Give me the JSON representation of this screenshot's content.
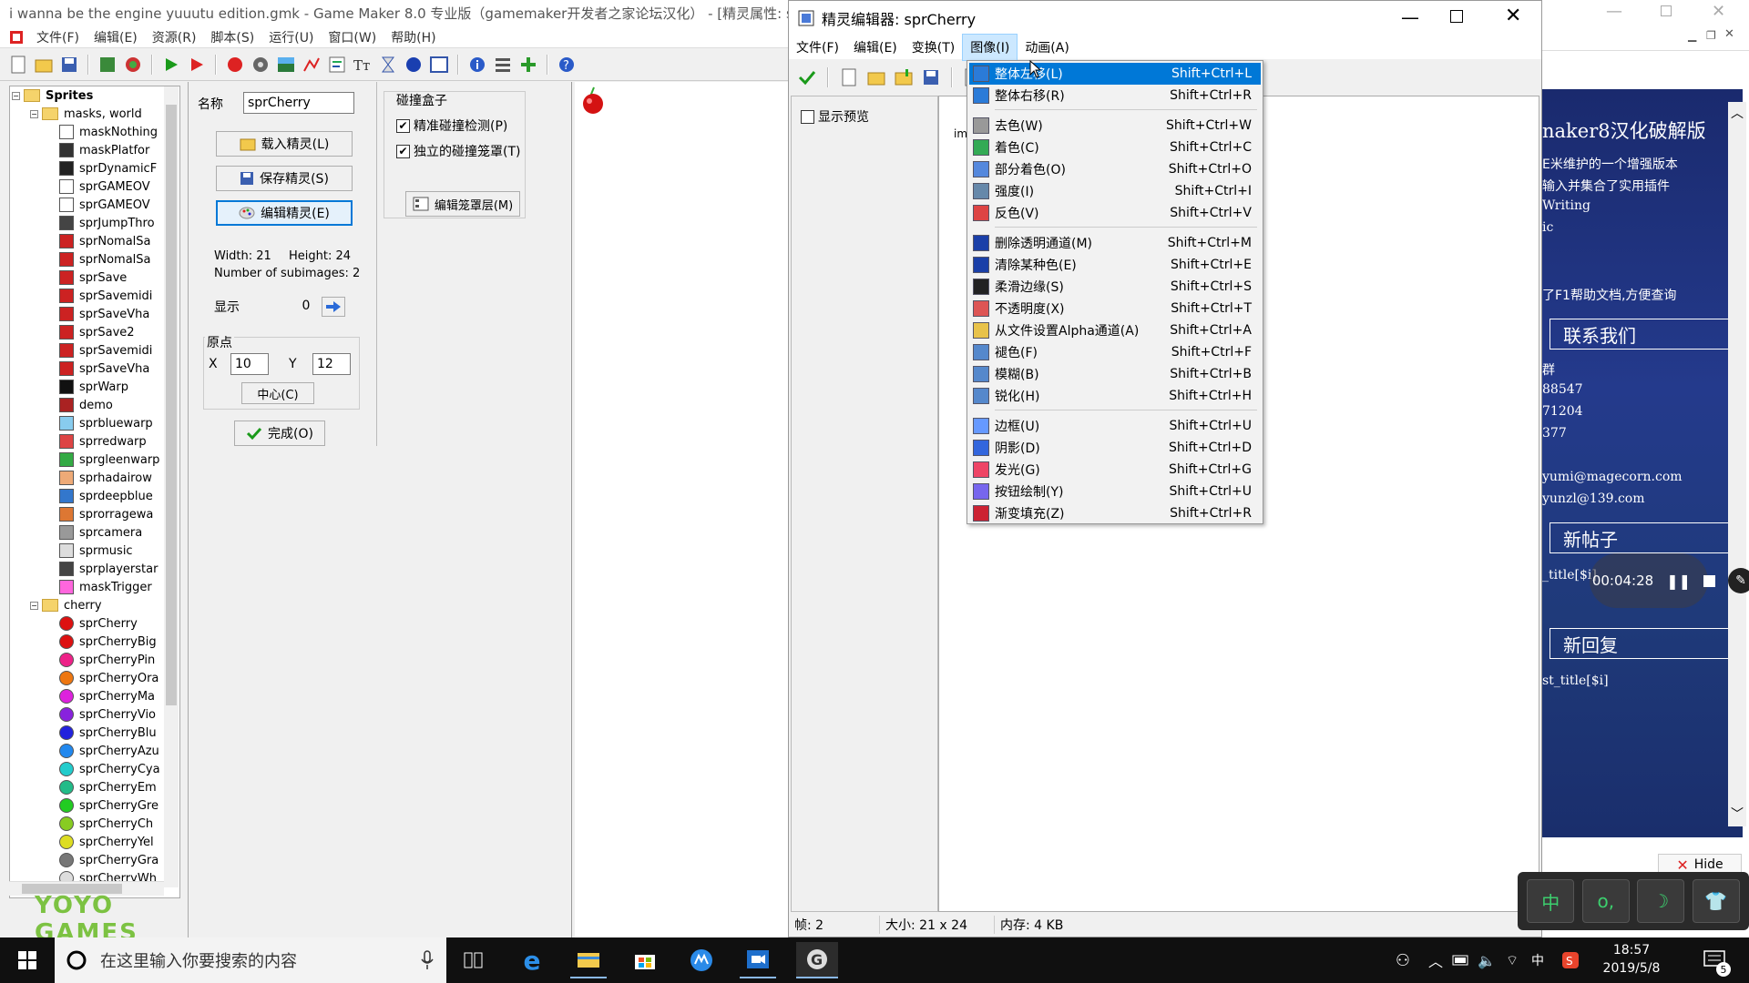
{
  "gm": {
    "title": "i wanna be the engine yuuutu edition.gmk - Game Maker 8.0 专业版（gamemaker开发者之家论坛汉化） - [精灵属性: sp",
    "menu": [
      "文件(F)",
      "编辑(E)",
      "资源(R)",
      "脚本(S)",
      "运行(U)",
      "窗口(W)",
      "帮助(H)"
    ]
  },
  "tree": {
    "root": "Sprites",
    "folder1": "masks, world",
    "items1": [
      "maskNothing",
      "maskPlatfor",
      "sprDynamicF",
      "sprGAMEOV",
      "sprGAMEOV",
      "sprJumpThro",
      "sprNomalSa",
      "sprNomalSa",
      "sprSave",
      "sprSavemidi",
      "sprSaveVha",
      "sprSave2",
      "sprSavemidi",
      "sprSaveVha",
      "sprWarp",
      "demo",
      "sprbluewarp",
      "sprredwarp",
      "sprgleenwarp",
      "sprhadairow",
      "sprdeepblue",
      "sprorragewa",
      "sprcamera",
      "sprmusic",
      "sprplayerstar",
      "maskTrigger"
    ],
    "folder2": "cherry",
    "items2": [
      "sprCherry",
      "sprCherryBig",
      "sprCherryPin",
      "sprCherryOra",
      "sprCherryMa",
      "sprCherryVio",
      "sprCherryBlu",
      "sprCherryAzu",
      "sprCherryCya",
      "sprCherryEm",
      "sprCherryGre",
      "sprCherryCh",
      "sprCherryYel",
      "sprCherryGra",
      "sprCherryWh"
    ],
    "colors1": [
      "#ffffff",
      "#333333",
      "#222222",
      "#ffffff",
      "#ffffff",
      "#444444",
      "#cc2222",
      "#cc2222",
      "#cc2222",
      "#cc2222",
      "#cc2222",
      "#cc2222",
      "#cc2222",
      "#cc2222",
      "#111111",
      "#aa2222",
      "#88ccee",
      "#dd4444",
      "#33aa44",
      "#eeaa77",
      "#3377cc",
      "#dd7733",
      "#999999",
      "#dddddd",
      "#444444",
      "#ff66dd"
    ],
    "colors2": [
      "#dd1111",
      "#dd1111",
      "#ee2288",
      "#ee7711",
      "#dd22dd",
      "#8822dd",
      "#2222dd",
      "#2288ee",
      "#22cccc",
      "#22bb88",
      "#22cc22",
      "#88cc22",
      "#dddd22",
      "#777777",
      "#dddddd"
    ]
  },
  "logo": "YOYO GAMES",
  "props": {
    "name_label": "名称",
    "name_value": "sprCherry",
    "load_btn": "载入精灵(L)",
    "save_btn": "保存精灵(S)",
    "edit_btn": "编辑精灵(E)",
    "width": "Width: 21",
    "height": "Height: 24",
    "subimages": "Number of subimages: 2",
    "show_label": "显示",
    "show_value": "0",
    "origin_label": "原点",
    "x_label": "X",
    "x_value": "10",
    "y_label": "Y",
    "y_value": "12",
    "center_btn": "中心(C)",
    "done_btn": "完成(O)",
    "collision_label": "碰撞盒子",
    "precise_chk": "精准碰撞检测(P)",
    "separate_chk": "独立的碰撞笼罩(T)",
    "mask_btn": "编辑笼罩层(M)"
  },
  "editor": {
    "title": "精灵编辑器: sprCherry",
    "menu": [
      "文件(F)",
      "编辑(E)",
      "变换(T)",
      "图像(I)",
      "动画(A)"
    ],
    "preview_chk": "显示预览",
    "canvas_text": "im",
    "status_frames": "帧: 2",
    "status_size": "大小: 21 x 24",
    "status_mem": "内存: 4 KB"
  },
  "dropdown": [
    {
      "label": "整体左移(L)",
      "shortcut": "Shift+Ctrl+L",
      "icon": "shift-left-icon",
      "color": "#2b7bd8"
    },
    {
      "label": "整体右移(R)",
      "shortcut": "Shift+Ctrl+R",
      "icon": "shift-right-icon",
      "color": "#2b7bd8"
    },
    {
      "label": "去色(W)",
      "shortcut": "Shift+Ctrl+W",
      "icon": "grayscale-icon",
      "color": "#999999"
    },
    {
      "label": "着色(C)",
      "shortcut": "Shift+Ctrl+C",
      "icon": "colorize-icon",
      "color": "#33aa55"
    },
    {
      "label": "部分着色(O)",
      "shortcut": "Shift+Ctrl+O",
      "icon": "partial-colorize-icon",
      "color": "#5588dd"
    },
    {
      "label": "强度(I)",
      "shortcut": "Shift+Ctrl+I",
      "icon": "intensity-icon",
      "color": "#6688aa"
    },
    {
      "label": "反色(V)",
      "shortcut": "Shift+Ctrl+V",
      "icon": "invert-icon",
      "color": "#dd4444"
    },
    {
      "label": "删除透明通道(M)",
      "shortcut": "Shift+Ctrl+M",
      "icon": "remove-alpha-icon",
      "color": "#1a3fa8"
    },
    {
      "label": "清除某种色(E)",
      "shortcut": "Shift+Ctrl+E",
      "icon": "erase-color-icon",
      "color": "#1a3fa8"
    },
    {
      "label": "柔滑边缘(S)",
      "shortcut": "Shift+Ctrl+S",
      "icon": "smooth-edges-icon",
      "color": "#222222"
    },
    {
      "label": "不透明度(X)",
      "shortcut": "Shift+Ctrl+T",
      "icon": "opacity-icon",
      "color": "#dd5555"
    },
    {
      "label": "从文件设置Alpha通道(A)",
      "shortcut": "Shift+Ctrl+A",
      "icon": "alpha-file-icon",
      "color": "#e8c24a"
    },
    {
      "label": "褪色(F)",
      "shortcut": "Shift+Ctrl+F",
      "icon": "fade-icon",
      "color": "#5588cc"
    },
    {
      "label": "模糊(B)",
      "shortcut": "Shift+Ctrl+B",
      "icon": "blur-icon",
      "color": "#5588cc"
    },
    {
      "label": "锐化(H)",
      "shortcut": "Shift+Ctrl+H",
      "icon": "sharpen-icon",
      "color": "#5588cc"
    },
    {
      "label": "边框(U)",
      "shortcut": "Shift+Ctrl+U",
      "icon": "outline-icon",
      "color": "#6699ff"
    },
    {
      "label": "阴影(D)",
      "shortcut": "Shift+Ctrl+D",
      "icon": "shadow-icon",
      "color": "#3366dd"
    },
    {
      "label": "发光(G)",
      "shortcut": "Shift+Ctrl+G",
      "icon": "glow-icon",
      "color": "#ee4466"
    },
    {
      "label": "按钮绘制(Y)",
      "shortcut": "Shift+Ctrl+U",
      "icon": "button-icon",
      "color": "#7766ee"
    },
    {
      "label": "渐变填充(Z)",
      "shortcut": "Shift+Ctrl+R",
      "icon": "gradient-icon",
      "color": "#cc2233"
    }
  ],
  "web": {
    "heading": "naker8汉化破解版",
    "l1": "E米维护的一个增强版本",
    "l2": "输入并集合了实用插件",
    "l3": "Writing",
    "l4": "ic",
    "l5": "了F1帮助文档,方便查询",
    "contact": "联系我们",
    "l6": "群",
    "l7": "88547",
    "l8": "71204",
    "l9": "377",
    "l10": "yumi@magecorn.com",
    "l11": "yunzl@139.com",
    "newpost": "新帖子",
    "l12": "_title[$i]",
    "reply": "新回复",
    "l13": "st_title[$i]",
    "hide": "Hide"
  },
  "recorder": {
    "time": "00:04:28"
  },
  "ime": [
    "中",
    "o,",
    "☽",
    "👕"
  ],
  "taskbar": {
    "search_placeholder": "在这里输入你要搜索的内容",
    "time": "18:57",
    "date": "2019/5/8",
    "lang": "中",
    "notif_count": "5"
  }
}
